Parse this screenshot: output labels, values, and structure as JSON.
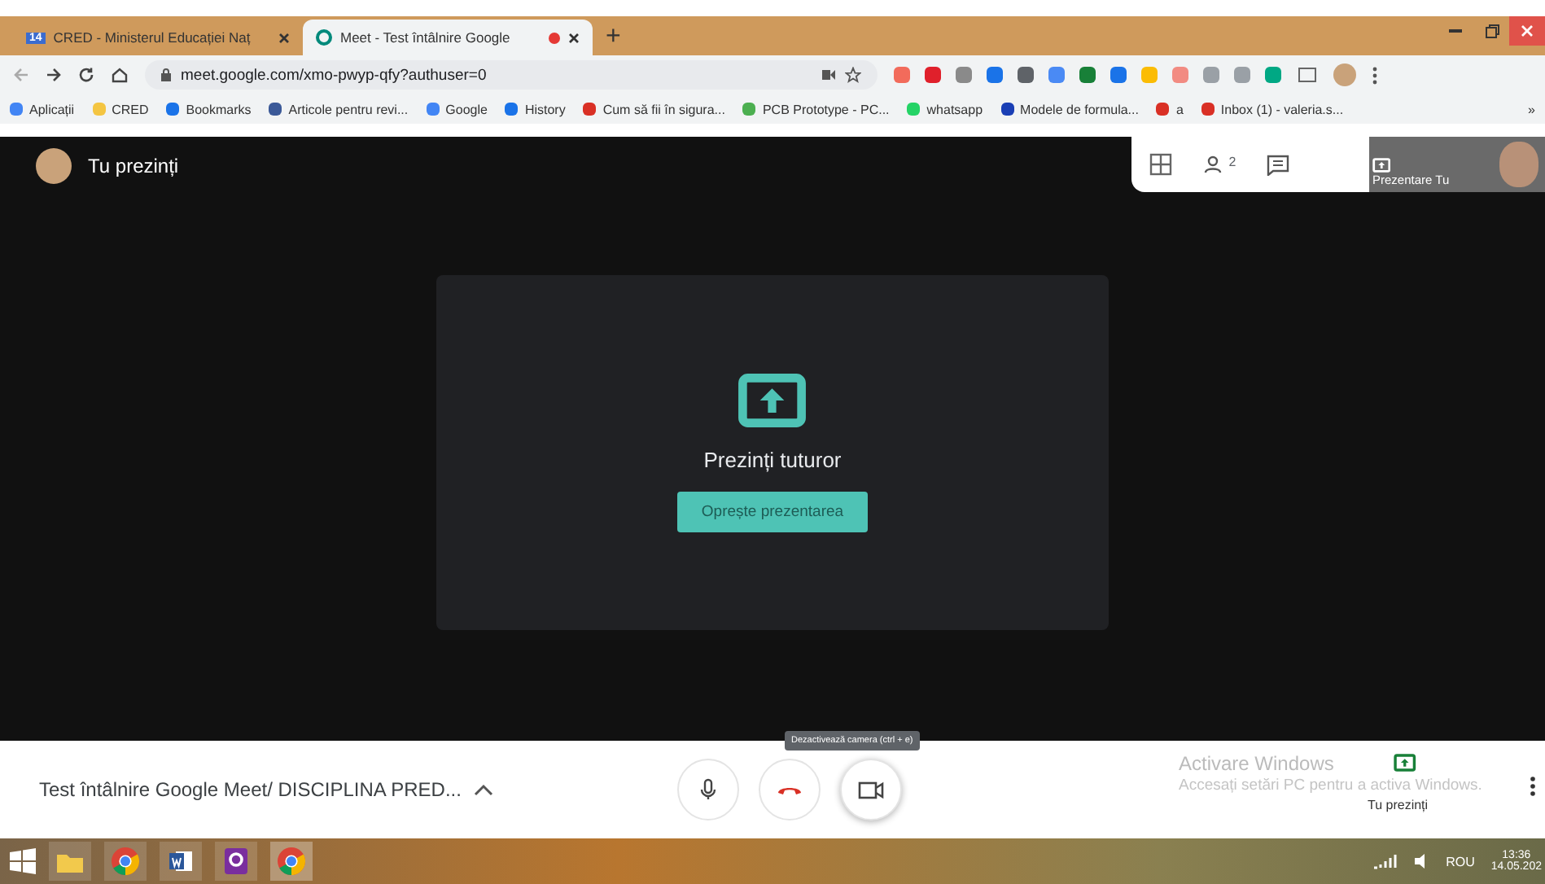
{
  "tabs": [
    {
      "label": "CRED - Ministerul Educației Naț",
      "selected": false,
      "badge": "14",
      "recording": false
    },
    {
      "label": "Meet - Test întâlnire Google",
      "selected": true,
      "recording": true
    }
  ],
  "new_tab": "+",
  "address": {
    "url": "meet.google.com/xmo-pwyp-qfy?authuser=0"
  },
  "extensions": [
    {
      "color": "#f26b5b"
    },
    {
      "color": "#e0202b"
    },
    {
      "color": "#8a8a8a"
    },
    {
      "color": "#1a73e8"
    },
    {
      "color": "#5f6368"
    },
    {
      "color": "#4a8af4"
    },
    {
      "color": "#188038"
    },
    {
      "color": "#1a73e8"
    },
    {
      "color": "#fbbc04"
    },
    {
      "color": "#f28b82"
    },
    {
      "color": "#9aa0a6"
    },
    {
      "color": "#9aa0a6"
    },
    {
      "color": "#00a884"
    }
  ],
  "bookmarks": [
    {
      "label": "Aplicații",
      "color": "#4285f4"
    },
    {
      "label": "CRED",
      "color": "#f4c542"
    },
    {
      "label": "Bookmarks",
      "color": "#1a73e8"
    },
    {
      "label": "Articole pentru revi...",
      "color": "#3b5998"
    },
    {
      "label": "Google",
      "color": "#4285f4"
    },
    {
      "label": "History",
      "color": "#1a73e8"
    },
    {
      "label": "Cum să fii în sigura...",
      "color": "#d93025"
    },
    {
      "label": "PCB Prototype - PC...",
      "color": "#4caf50"
    },
    {
      "label": "whatsapp",
      "color": "#25d366"
    },
    {
      "label": "Modele de formula...",
      "color": "#1a3fb5"
    },
    {
      "label": "a",
      "color": "#d93025"
    },
    {
      "label": "Inbox (1) - valeria.s...",
      "color": "#d93025"
    }
  ],
  "bookmarks_more": "»",
  "meet": {
    "presenter": "Tu prezinți",
    "people_count": "2",
    "tile_label": "Prezentare",
    "tile_name": "Tu",
    "card_title": "Prezinți tuturor",
    "stop_button": "Oprește prezentarea",
    "meeting_title": "Test întâlnire Google Meet/ DISCIPLINA PRED...",
    "tooltip": "Dezactivează camera (ctrl + e)",
    "presenting_label": "Tu prezinți"
  },
  "activation": {
    "title": "Activare Windows",
    "text": "Accesați setări PC pentru a activa Windows."
  },
  "taskbar": {
    "language": "ROU",
    "time": "13:36",
    "date": "14.05.202"
  }
}
